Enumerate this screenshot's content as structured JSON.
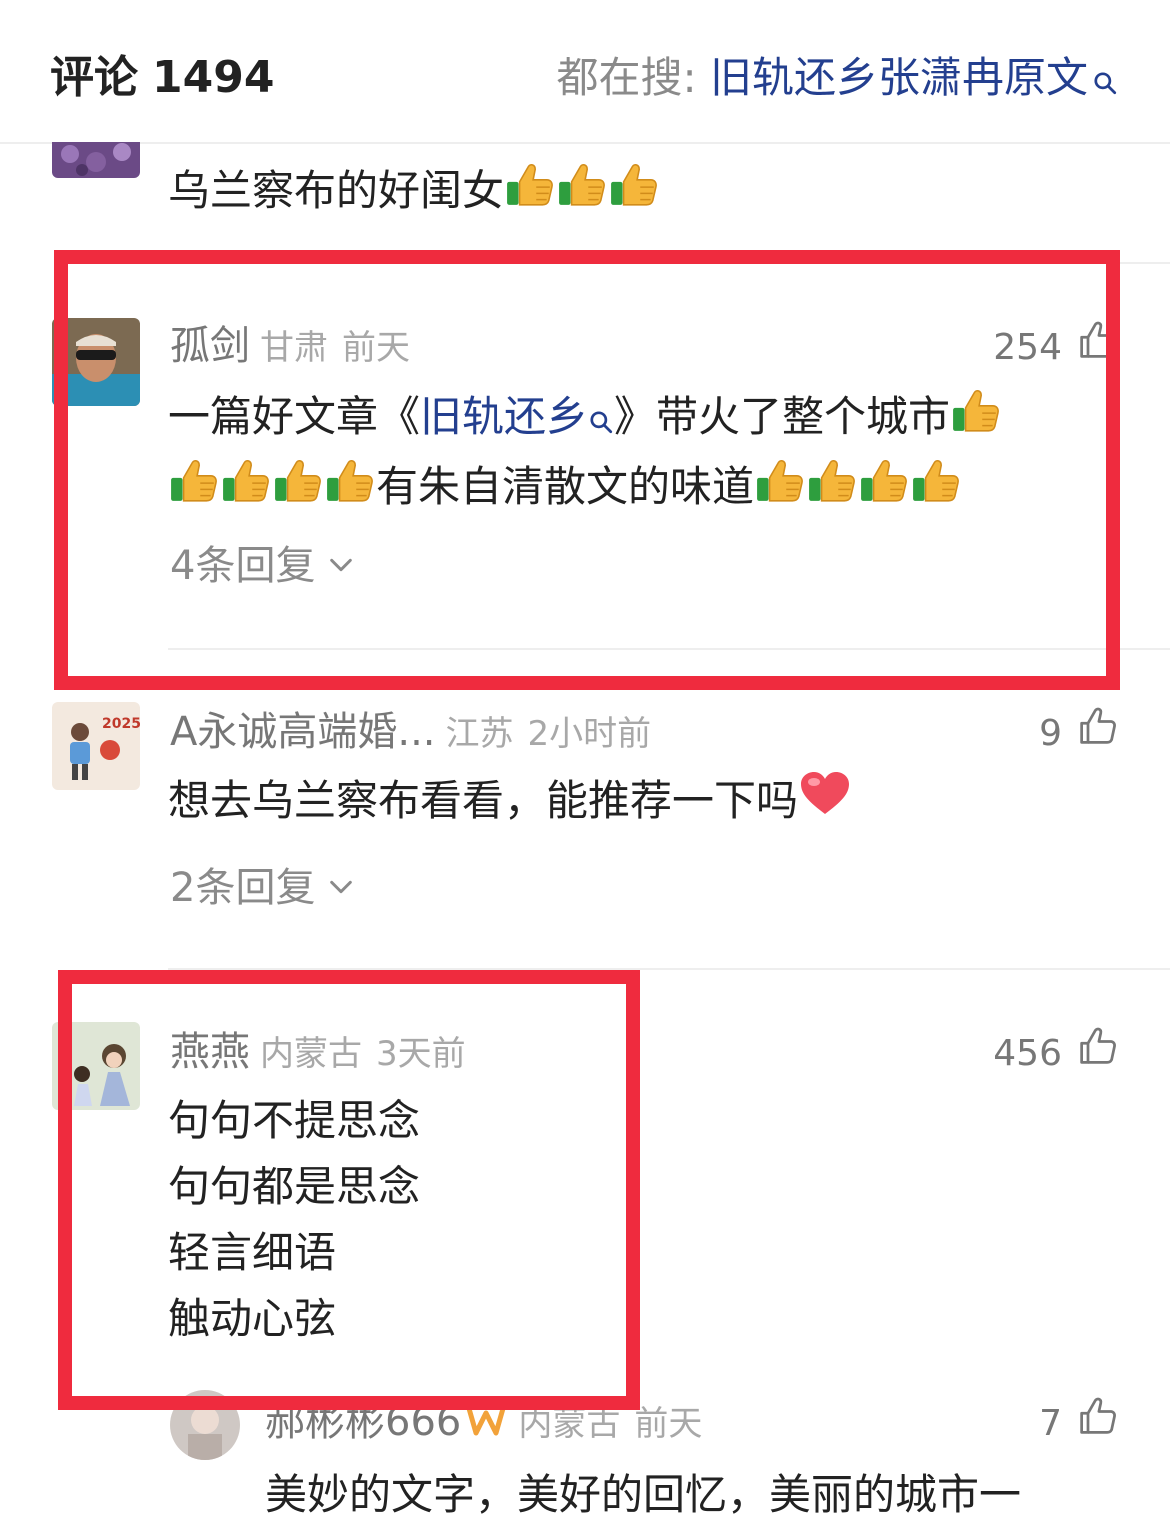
{
  "header": {
    "title": "评论",
    "count": "1494",
    "hot_search_prefix": "都在搜: ",
    "hot_search_keyword": "旧轨还乡张潇冉原文"
  },
  "comments": [
    {
      "text": "乌兰察布的好闺女",
      "emoji": [
        "thumbs-up",
        "thumbs-up",
        "thumbs-up"
      ]
    },
    {
      "name": "孤剑",
      "region": "甘肃",
      "time": "前天",
      "likes": "254",
      "text_before": "一篇好文章《",
      "text_link": "旧轨还乡",
      "text_after": "》带火了整个城市",
      "text_middle": "有朱自清散文的味道",
      "replies": "4条回复"
    },
    {
      "name": "A永诚高端婚...",
      "region": "江苏",
      "time": "2小时前",
      "likes": "9",
      "text": "想去乌兰察布看看，能推荐一下吗",
      "replies": "2条回复"
    },
    {
      "name": "燕燕",
      "region": "内蒙古",
      "time": "3天前",
      "likes": "456",
      "lines": [
        "句句不提思念",
        "句句都是思念",
        "轻言细语",
        "触动心弦"
      ]
    }
  ],
  "reply": {
    "name": "郝彬彬666",
    "region": "内蒙古",
    "time": "前天",
    "likes": "7",
    "text": "美妙的文字，美好的回忆，美丽的城市一"
  },
  "colors": {
    "highlight_border": "#ef2b3e",
    "link": "#233f8f",
    "meta_gray": "#a8a8a8"
  }
}
